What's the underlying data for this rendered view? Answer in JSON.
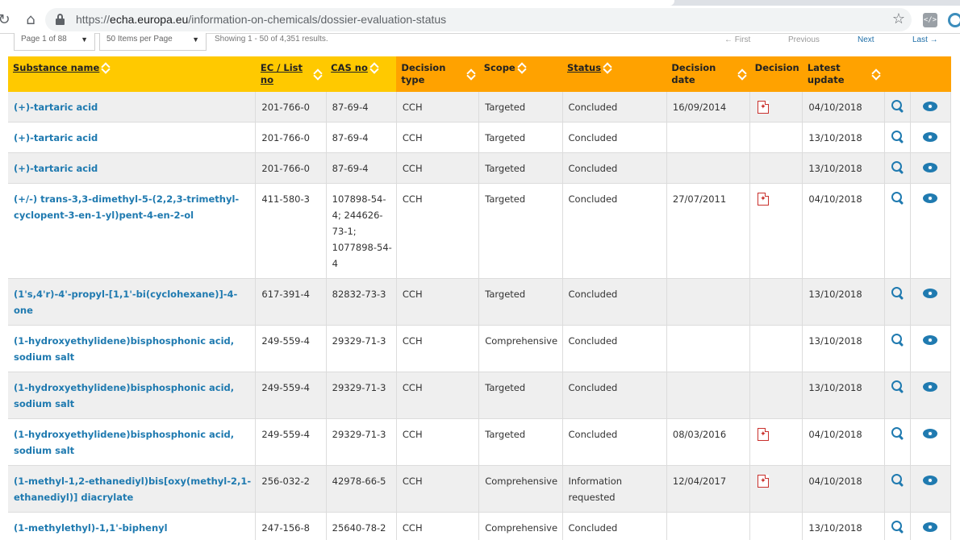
{
  "browser": {
    "url_prefix": "https://",
    "url_host": "echa.europa.eu",
    "url_path": "/information-on-chemicals/dossier-evaluation-status"
  },
  "pager": {
    "page_select": "Page 1 of 88",
    "per_page_select": "50 Items per Page",
    "showing": "Showing 1 - 50 of 4,351 results.",
    "first": "← First",
    "previous": "Previous",
    "next": "Next",
    "last": "Last →"
  },
  "table": {
    "headers": {
      "substance": "Substance name",
      "ec": "EC / List no",
      "cas": "CAS no",
      "decision_type": "Decision type",
      "scope": "Scope",
      "status": "Status",
      "decision_date": "Decision date",
      "decision": "Decision",
      "latest_update": "Latest update"
    },
    "rows": [
      {
        "name": "(+)-tartaric acid",
        "ec": "201-766-0",
        "cas": "87-69-4",
        "type": "CCH",
        "scope": "Targeted",
        "status": "Concluded",
        "date": "16/09/2014",
        "pdf": true,
        "updated": "04/10/2018"
      },
      {
        "name": "(+)-tartaric acid",
        "ec": "201-766-0",
        "cas": "87-69-4",
        "type": "CCH",
        "scope": "Targeted",
        "status": "Concluded",
        "date": "",
        "pdf": false,
        "updated": "13/10/2018"
      },
      {
        "name": "(+)-tartaric acid",
        "ec": "201-766-0",
        "cas": "87-69-4",
        "type": "CCH",
        "scope": "Targeted",
        "status": "Concluded",
        "date": "",
        "pdf": false,
        "updated": "13/10/2018"
      },
      {
        "name": "(+/-) trans-3,3-dimethyl-5-(2,2,3-trimethyl-cyclopent-3-en-1-yl)pent-4-en-2-ol",
        "ec": "411-580-3",
        "cas": "107898-54-4; 244626-73-1; 1077898-54-4",
        "type": "CCH",
        "scope": "Targeted",
        "status": "Concluded",
        "date": "27/07/2011",
        "pdf": true,
        "updated": "04/10/2018"
      },
      {
        "name": "(1's,4'r)-4'-propyl-[1,1'-bi(cyclohexane)]-4-one",
        "ec": "617-391-4",
        "cas": "82832-73-3",
        "type": "CCH",
        "scope": "Targeted",
        "status": "Concluded",
        "date": "",
        "pdf": false,
        "updated": "13/10/2018"
      },
      {
        "name": "(1-hydroxyethylidene)bisphosphonic acid, sodium salt",
        "ec": "249-559-4",
        "cas": "29329-71-3",
        "type": "CCH",
        "scope": "Comprehensive",
        "status": "Concluded",
        "date": "",
        "pdf": false,
        "updated": "13/10/2018"
      },
      {
        "name": "(1-hydroxyethylidene)bisphosphonic acid, sodium salt",
        "ec": "249-559-4",
        "cas": "29329-71-3",
        "type": "CCH",
        "scope": "Targeted",
        "status": "Concluded",
        "date": "",
        "pdf": false,
        "updated": "13/10/2018"
      },
      {
        "name": "(1-hydroxyethylidene)bisphosphonic acid, sodium salt",
        "ec": "249-559-4",
        "cas": "29329-71-3",
        "type": "CCH",
        "scope": "Targeted",
        "status": "Concluded",
        "date": "08/03/2016",
        "pdf": true,
        "updated": "04/10/2018"
      },
      {
        "name": "(1-methyl-1,2-ethanediyl)bis[oxy(methyl-2,1-ethanediyl)] diacrylate",
        "ec": "256-032-2",
        "cas": "42978-66-5",
        "type": "CCH",
        "scope": "Comprehensive",
        "status": "Information requested",
        "date": "12/04/2017",
        "pdf": true,
        "updated": "04/10/2018"
      },
      {
        "name": "(1-methylethyl)-1,1'-biphenyl",
        "ec": "247-156-8",
        "cas": "25640-78-2",
        "type": "CCH",
        "scope": "Comprehensive",
        "status": "Concluded",
        "date": "",
        "pdf": false,
        "updated": "13/10/2018"
      }
    ]
  }
}
